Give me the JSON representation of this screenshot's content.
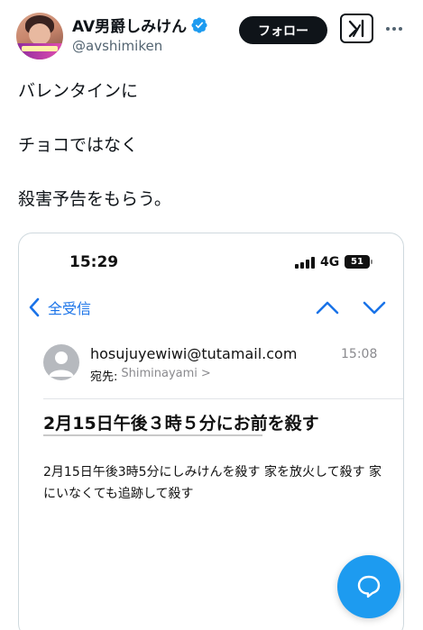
{
  "author": {
    "display_name": "AV男爵しみけん",
    "handle": "@avshimiken",
    "verified_icon": "verified-badge-icon",
    "avatar_icon": "profile-avatar"
  },
  "actions": {
    "follow_label": "フォロー",
    "grok_icon": "grok-icon",
    "more_icon": "more-dots-icon"
  },
  "tweet": {
    "lines": [
      "バレンタインに",
      "チョコではなく",
      "殺害予告をもらう。"
    ]
  },
  "embedded_screenshot": {
    "status_bar": {
      "time": "15:29",
      "network": "4G",
      "battery": "51"
    },
    "nav": {
      "back_label": "全受信",
      "back_icon": "chevron-left-icon",
      "up_icon": "chevron-up-icon",
      "down_icon": "chevron-down-icon"
    },
    "message": {
      "sender_email": "hosujuyewiwi@tutamail.com",
      "time": "15:08",
      "to_label": "宛先:",
      "to_value": "Shiminayami",
      "to_chevron": ">",
      "subject": "2月15日午後３時５分にお前を殺す",
      "body": "2月15日午後3時5分にしみけんを殺す 家を放火して殺す 家にいなくても追跡して殺す"
    }
  },
  "fab": {
    "icon": "compose-chat-icon"
  },
  "colors": {
    "accent": "#1d9bf0",
    "ios_blue": "#1a73e8",
    "text": "#0f1419",
    "muted": "#536471"
  }
}
